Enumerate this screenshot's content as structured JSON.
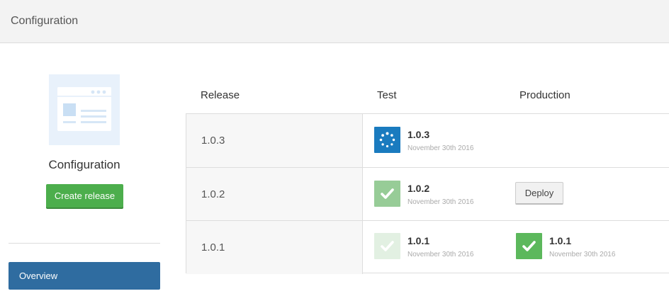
{
  "header": {
    "title": "Configuration"
  },
  "sidebar": {
    "project_icon": "browser-window-icon",
    "project_name": "Configuration",
    "create_release_label": "Create release",
    "nav": [
      {
        "label": "Overview",
        "active": true
      }
    ]
  },
  "table": {
    "headers": {
      "release": "Release",
      "test": "Test",
      "production": "Production"
    },
    "rows": [
      {
        "release": "1.0.3",
        "test": {
          "status": "running",
          "icon": "spinner-icon",
          "version": "1.0.3",
          "date": "November 30th 2016"
        },
        "production": null
      },
      {
        "release": "1.0.2",
        "test": {
          "status": "success",
          "icon": "check-icon",
          "version": "1.0.2",
          "date": "November 30th 2016"
        },
        "production": {
          "action_label": "Deploy"
        }
      },
      {
        "release": "1.0.1",
        "test": {
          "status": "superseded",
          "icon": "check-icon",
          "version": "1.0.1",
          "date": "November 30th 2016"
        },
        "production": {
          "status": "deployed",
          "icon": "check-icon",
          "version": "1.0.1",
          "date": "November 30th 2016"
        }
      }
    ]
  },
  "colors": {
    "primary": "#2f6ca0",
    "success": "#4cae4c",
    "running": "#1a7bbf",
    "header_bg": "#f3f3f3"
  }
}
